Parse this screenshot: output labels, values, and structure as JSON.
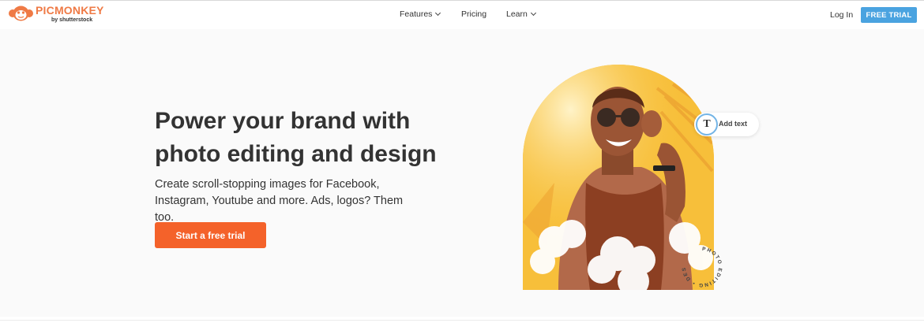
{
  "brand": {
    "name": "PICMONKEY",
    "sub": "by shutterstock",
    "accent": "#ef7a45"
  },
  "nav": {
    "items": [
      {
        "label": "Features",
        "has_dropdown": true
      },
      {
        "label": "Pricing",
        "has_dropdown": false
      },
      {
        "label": "Learn",
        "has_dropdown": true
      }
    ],
    "login_label": "Log In",
    "trial_label": "FREE TRIAL",
    "trial_color": "#4aa3e0"
  },
  "hero": {
    "headline_line1": "Power your brand with",
    "headline_line2": "photo editing and design",
    "sub_line1": "Create scroll-stopping images for Facebook,",
    "sub_line2": "Instagram, Youtube and more. Ads, logos? Them too.",
    "cta_label": "Start a free trial",
    "cta_color": "#f4622a"
  },
  "visual": {
    "add_text_icon": "T",
    "add_text_label": "Add text",
    "badge_text": "PHOTO EDITING • DESIGN •",
    "arch_color": "#f8c13c"
  }
}
